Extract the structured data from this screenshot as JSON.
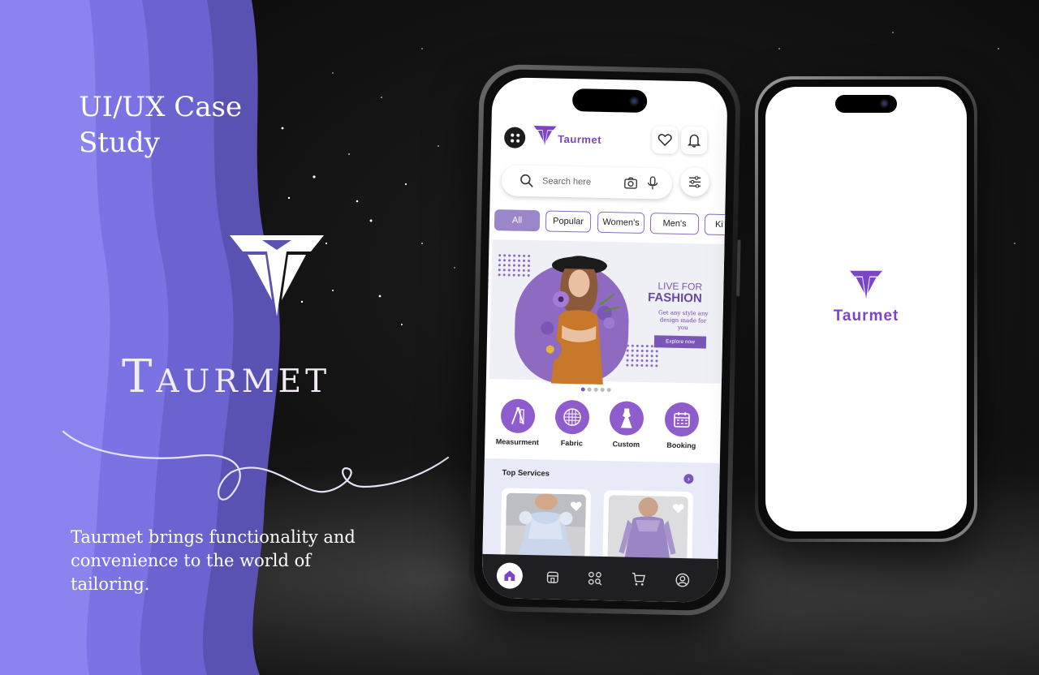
{
  "hero": {
    "case_title": "UI/UX Case Study",
    "brand_name": "Taurmet",
    "tagline": "Taurmet brings functionality and convenience to the world of tailoring."
  },
  "colors": {
    "accent": "#7b44c9",
    "accent_soft": "#8e5ccc",
    "band_light": "#8b84f0",
    "band_dark": "#5a52b3",
    "background": "#0c0c0c"
  },
  "app": {
    "logo_text": "Taurmet",
    "header_icons": [
      "heart-icon",
      "bell-icon"
    ],
    "search": {
      "placeholder": "Search here",
      "icons": [
        "search-icon",
        "camera-icon",
        "microphone-icon"
      ]
    },
    "filter_icon": "sliders-icon",
    "chips": [
      "All",
      "Popular",
      "Women's",
      "Men's",
      "Ki"
    ],
    "active_chip": "All",
    "banner": {
      "line1": "LIVE FOR",
      "line2": "FASHION",
      "subtitle": "Get any style any design made for you",
      "cta": "Explore now"
    },
    "pager": {
      "pages": 5,
      "active": 1
    },
    "categories": [
      {
        "label": "Measurment",
        "icon": "ruler-compass-icon"
      },
      {
        "label": "Fabric",
        "icon": "fabric-icon"
      },
      {
        "label": "Custom",
        "icon": "dress-icon"
      },
      {
        "label": "Booking",
        "icon": "calendar-icon"
      }
    ],
    "top_services": {
      "title": "Top Services",
      "arrow_icon": "chevron-right-icon"
    },
    "tabbar": [
      "home-icon",
      "store-icon",
      "categories-icon",
      "cart-icon",
      "profile-icon"
    ],
    "active_tab": "home-icon"
  },
  "splash": {
    "logo_text": "Taurmet"
  }
}
